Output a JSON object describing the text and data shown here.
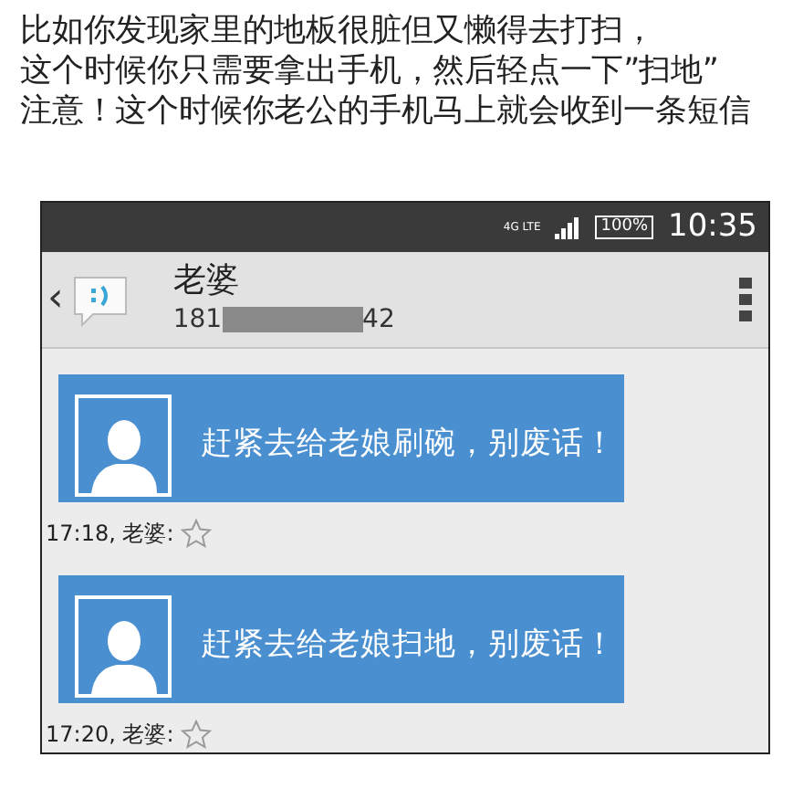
{
  "caption": [
    "比如你发现家里的地板很脏但又懒得去打扫，",
    "这个时候你只需要拿出手机，然后轻点一下”扫地”",
    "注意！这个时候你老公的手机马上就会收到一条短信"
  ],
  "status_bar": {
    "network": "4G LTE",
    "battery": "100%",
    "time": "10:35"
  },
  "header": {
    "back": "‹",
    "contact_name": "老婆",
    "number_start": "181",
    "number_end": "42"
  },
  "messages": [
    {
      "text": "赶紧去给老娘刷碗，别废话！",
      "meta": "17:18, 老婆:",
      "starred": false
    },
    {
      "text": "赶紧去给老娘扫地，别废话！",
      "meta": "17:20, 老婆:",
      "starred": false
    }
  ]
}
